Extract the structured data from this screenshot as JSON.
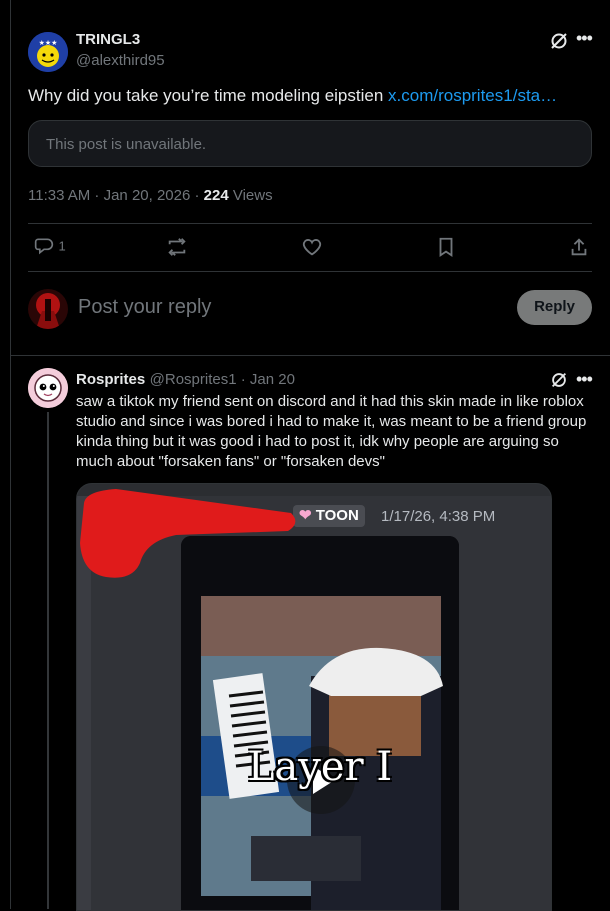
{
  "post": {
    "author_name": "TRINGL3",
    "author_handle": "@alexthird95",
    "text": "Why did you take you’re time modeling eipstien ",
    "link": "x.com/rosprites1/sta…",
    "quote_unavailable": "This post is unavailable.",
    "time": "11:33 AM · Jan 20, 2026 · ",
    "views_count": "224",
    "views_label": " Views"
  },
  "actions": {
    "reply_count": "1"
  },
  "composer": {
    "placeholder": "Post your reply",
    "button": "Reply"
  },
  "reply": {
    "author_name": "Rosprites",
    "author_handle": "@Rosprites1",
    "date": " · Jan 20",
    "text": "saw a tiktok my friend sent on discord and it had this skin made in like roblox studio and since i was bored i had to make it, was meant to be a friend group kinda thing but it was good i had to post it, idk why people are arguing so much about \"forsaken fans\" or \"forsaken devs\"",
    "media": {
      "badge": "TOON",
      "timestamp": "1/17/26, 4:38 PM",
      "caption": "Layer I"
    }
  },
  "colors": {
    "link": "#1d9bf0",
    "muted": "#71767b",
    "redact": "#e01b1b"
  }
}
